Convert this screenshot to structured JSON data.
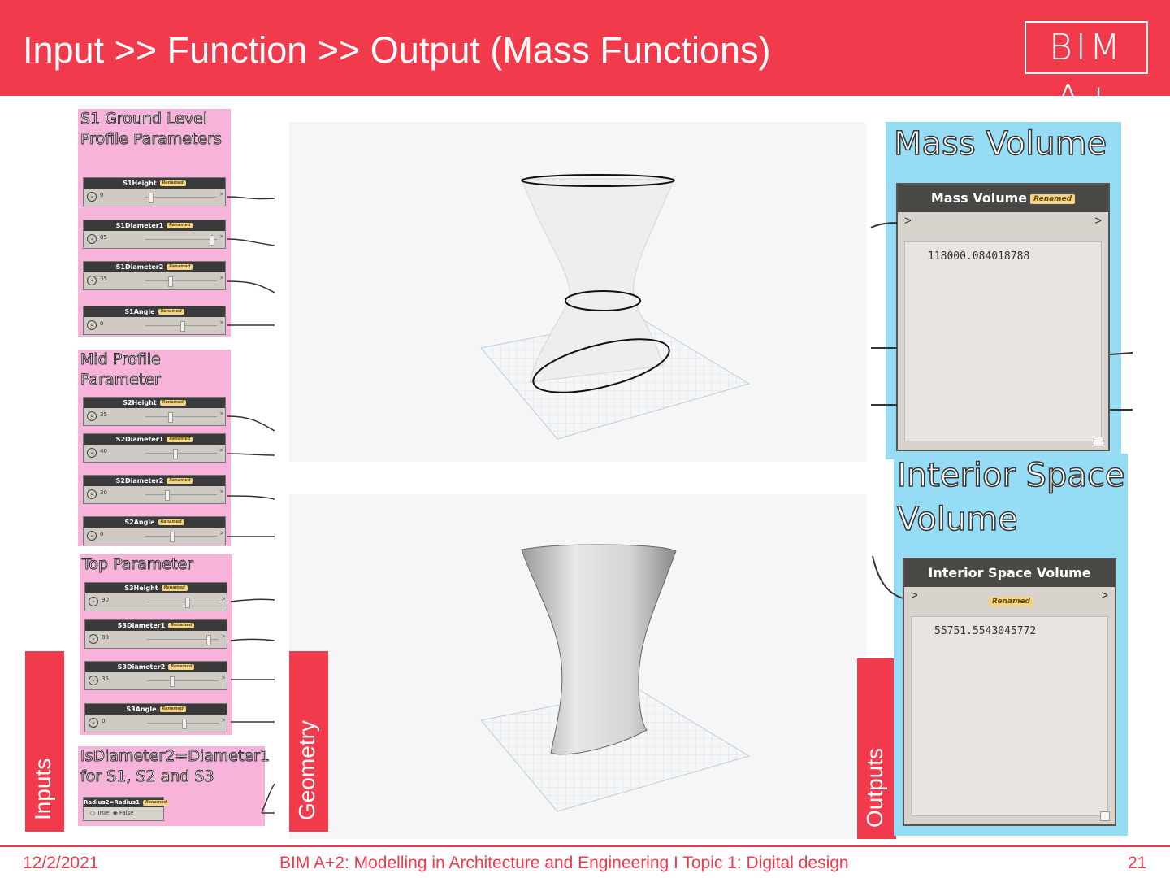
{
  "header": {
    "title": "Input >> Function >> Output (Mass Functions)",
    "logo": "BIM A+"
  },
  "groups": {
    "s1": {
      "title": "S1 Ground Level\nProfile Parameters",
      "sliders": [
        {
          "name": "S1Height",
          "value": "0",
          "level": 0.05
        },
        {
          "name": "S1Diameter1",
          "value": "85",
          "level": 0.92
        },
        {
          "name": "S1Diameter2",
          "value": "35",
          "level": 0.33
        },
        {
          "name": "S1Angle",
          "value": "0",
          "level": 0.5
        }
      ]
    },
    "mid": {
      "title": "Mid Profile\nParameter",
      "sliders": [
        {
          "name": "S2Height",
          "value": "35",
          "level": 0.33
        },
        {
          "name": "S2Diameter1",
          "value": "40",
          "level": 0.4
        },
        {
          "name": "S2Diameter2",
          "value": "30",
          "level": 0.28
        },
        {
          "name": "S2Angle",
          "value": "0",
          "level": 0.35
        }
      ]
    },
    "top": {
      "title": "Top Parameter",
      "sliders": [
        {
          "name": "S3Height",
          "value": "90",
          "level": 0.55
        },
        {
          "name": "S3Diameter1",
          "value": "80",
          "level": 0.85
        },
        {
          "name": "S3Diameter2",
          "value": "35",
          "level": 0.33
        },
        {
          "name": "S3Angle",
          "value": "0",
          "level": 0.5
        }
      ]
    },
    "bool": {
      "title": "IsDiameter2=Diameter1\nfor S1, S2 and S3",
      "node_name": "Radius2=Radius1",
      "option_true": "True",
      "option_false": "False",
      "selected": "False"
    }
  },
  "badge_text": "Renamed",
  "side_tabs": {
    "inputs": "Inputs",
    "geometry": "Geometry",
    "outputs": "Outputs"
  },
  "outputs": {
    "mass": {
      "title": "Mass Volume",
      "node_name": "Mass Volume",
      "value": "118000.084018788"
    },
    "interior": {
      "title": "Interior Space\nVolume",
      "node_name": "Interior Space Volume",
      "value": "55751.5543045772"
    }
  },
  "footer": {
    "date": "12/2/2021",
    "course": "BIM A+2: Modelling in Architecture and Engineering I Topic 1: Digital design",
    "page": "21"
  }
}
